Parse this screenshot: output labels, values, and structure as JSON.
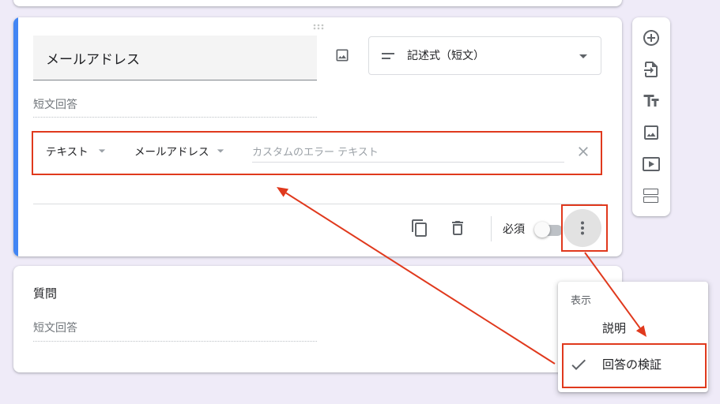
{
  "colors": {
    "background": "#efebf8",
    "card": "#ffffff",
    "accent": "#4285f4",
    "annotation": "#e0391d",
    "icon": "#5f6368",
    "text": "#202124",
    "muted": "#70757a"
  },
  "question_card": {
    "drag_icon": "drag-handle-icon",
    "title_value": "メールアドレス",
    "image_icon": "image-icon",
    "question_type": {
      "selected": "記述式（短文）",
      "icon": "short-text-icon",
      "arrow_icon": "dropdown-arrow-icon"
    },
    "answer_placeholder": "短文回答",
    "validation": {
      "type": "テキスト",
      "condition": "メールアドレス",
      "error_placeholder": "カスタムのエラー テキスト",
      "close_icon": "close-icon"
    },
    "footer": {
      "copy_icon": "copy-icon",
      "delete_icon": "delete-icon",
      "required_label": "必須",
      "required": false,
      "more_icon": "more-vert-icon"
    }
  },
  "second_card": {
    "title": "質問",
    "answer_placeholder": "短文回答"
  },
  "side_toolbar": {
    "items": [
      {
        "icon": "add-circle-icon"
      },
      {
        "icon": "import-icon"
      },
      {
        "icon": "title-icon"
      },
      {
        "icon": "image-icon"
      },
      {
        "icon": "video-icon"
      },
      {
        "icon": "section-icon"
      }
    ]
  },
  "context_menu": {
    "header": "表示",
    "items": [
      {
        "label": "説明",
        "checked": false
      },
      {
        "label": "回答の検証",
        "checked": true
      }
    ]
  }
}
